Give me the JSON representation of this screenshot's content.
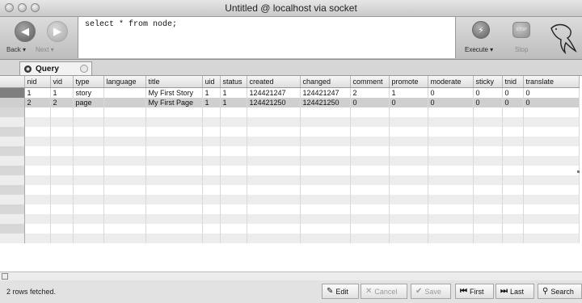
{
  "window": {
    "title": "Untitled @ localhost via socket"
  },
  "toolbar": {
    "back_label": "Back ▾",
    "next_label": "Next ▾",
    "query_text": "select * from node;",
    "execute_label": "Execute ▾",
    "stop_label": "Stop",
    "stop_icon_text": "STOP"
  },
  "tab": {
    "label": "Query"
  },
  "grid": {
    "columns": [
      "nid",
      "vid",
      "type",
      "language",
      "title",
      "uid",
      "status",
      "created",
      "changed",
      "comment",
      "promote",
      "moderate",
      "sticky",
      "tnid",
      "translate"
    ],
    "rows": [
      [
        "1",
        "1",
        "story",
        "",
        "My First Story",
        "1",
        "1",
        "124421247",
        "124421247",
        "2",
        "1",
        "0",
        "0",
        "0",
        "0"
      ],
      [
        "2",
        "2",
        "page",
        "",
        "My First Page",
        "1",
        "1",
        "124421250",
        "124421250",
        "0",
        "0",
        "0",
        "0",
        "0",
        "0"
      ]
    ]
  },
  "status": {
    "text": "2 rows fetched.",
    "buttons": {
      "edit": "Edit",
      "cancel": "Cancel",
      "save": "Save",
      "first": "First",
      "last": "Last",
      "search": "Search"
    }
  }
}
